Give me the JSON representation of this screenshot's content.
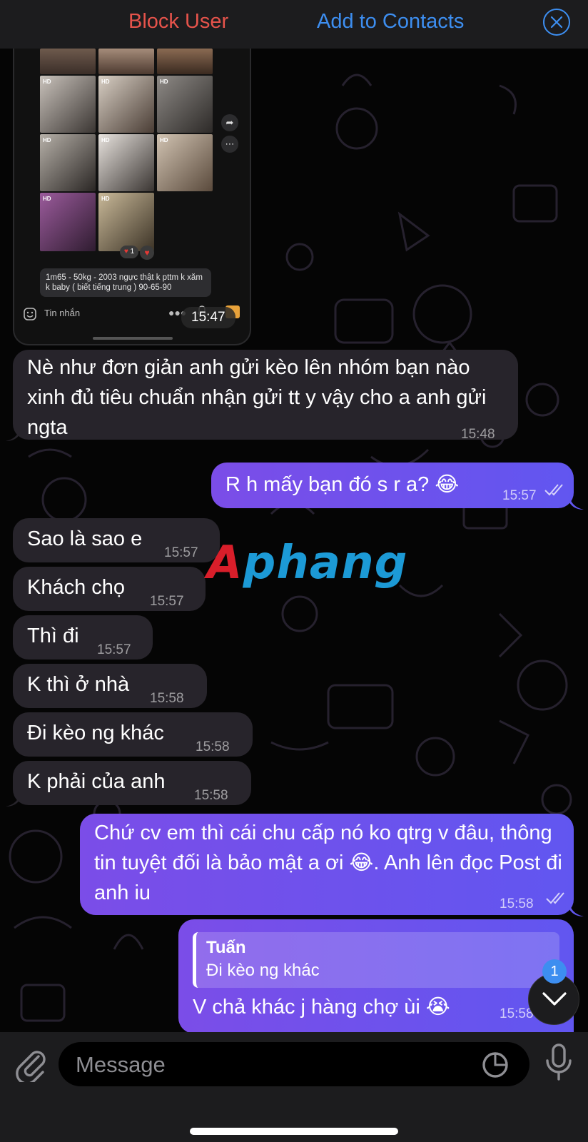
{
  "top_bar": {
    "block_label": "Block User",
    "add_label": "Add to Contacts",
    "close_icon": "close-circle-icon",
    "colors": {
      "block": "#e5534b",
      "accent": "#3d8ef0"
    }
  },
  "screenshot_message": {
    "caption": "1m65 - 50kg - 2003 ngực thật k pttm k xăm k baby ( biết tiếng trung ) 90-65-90",
    "input_placeholder": "Tin nhắn",
    "time": "15:47",
    "badge_hd": "HD",
    "reaction_count": "1"
  },
  "messages": [
    {
      "side": "in",
      "text": "Nè như đơn giản anh gửi kèo lên nhóm bạn nào xinh đủ tiêu chuẩn nhận gửi tt y vậy cho a anh gửi ngta",
      "time": "15:48"
    },
    {
      "side": "out",
      "text": "R h mấy bạn đó s r a? 😂",
      "time": "15:57",
      "read": true
    },
    {
      "side": "in",
      "text": "Sao là sao e",
      "time": "15:57"
    },
    {
      "side": "in",
      "text": "Khách chọ",
      "time": "15:57"
    },
    {
      "side": "in",
      "text": "Thì đi",
      "time": "15:57"
    },
    {
      "side": "in",
      "text": "K thì ở nhà",
      "time": "15:58"
    },
    {
      "side": "in",
      "text": "Đi kèo ng khác",
      "time": "15:58"
    },
    {
      "side": "in",
      "text": "K phải của anh",
      "time": "15:58"
    },
    {
      "side": "out",
      "text": "Chứ cv em thì cái chu cấp nó ko qtrg v đâu, thông tin tuyệt đối là bảo mật a ơi 😂. Anh lên đọc Post đi anh iu",
      "time": "15:58",
      "read": true
    },
    {
      "side": "out",
      "reply_name": "Tuấn",
      "reply_text": "Đi kèo ng khác",
      "text": "V chả khác j hàng chợ ùi 😭",
      "time": "15:58"
    }
  ],
  "watermark": {
    "first": "A",
    "rest": "phang"
  },
  "scroll": {
    "unread_count": "1"
  },
  "composer": {
    "placeholder": "Message"
  }
}
